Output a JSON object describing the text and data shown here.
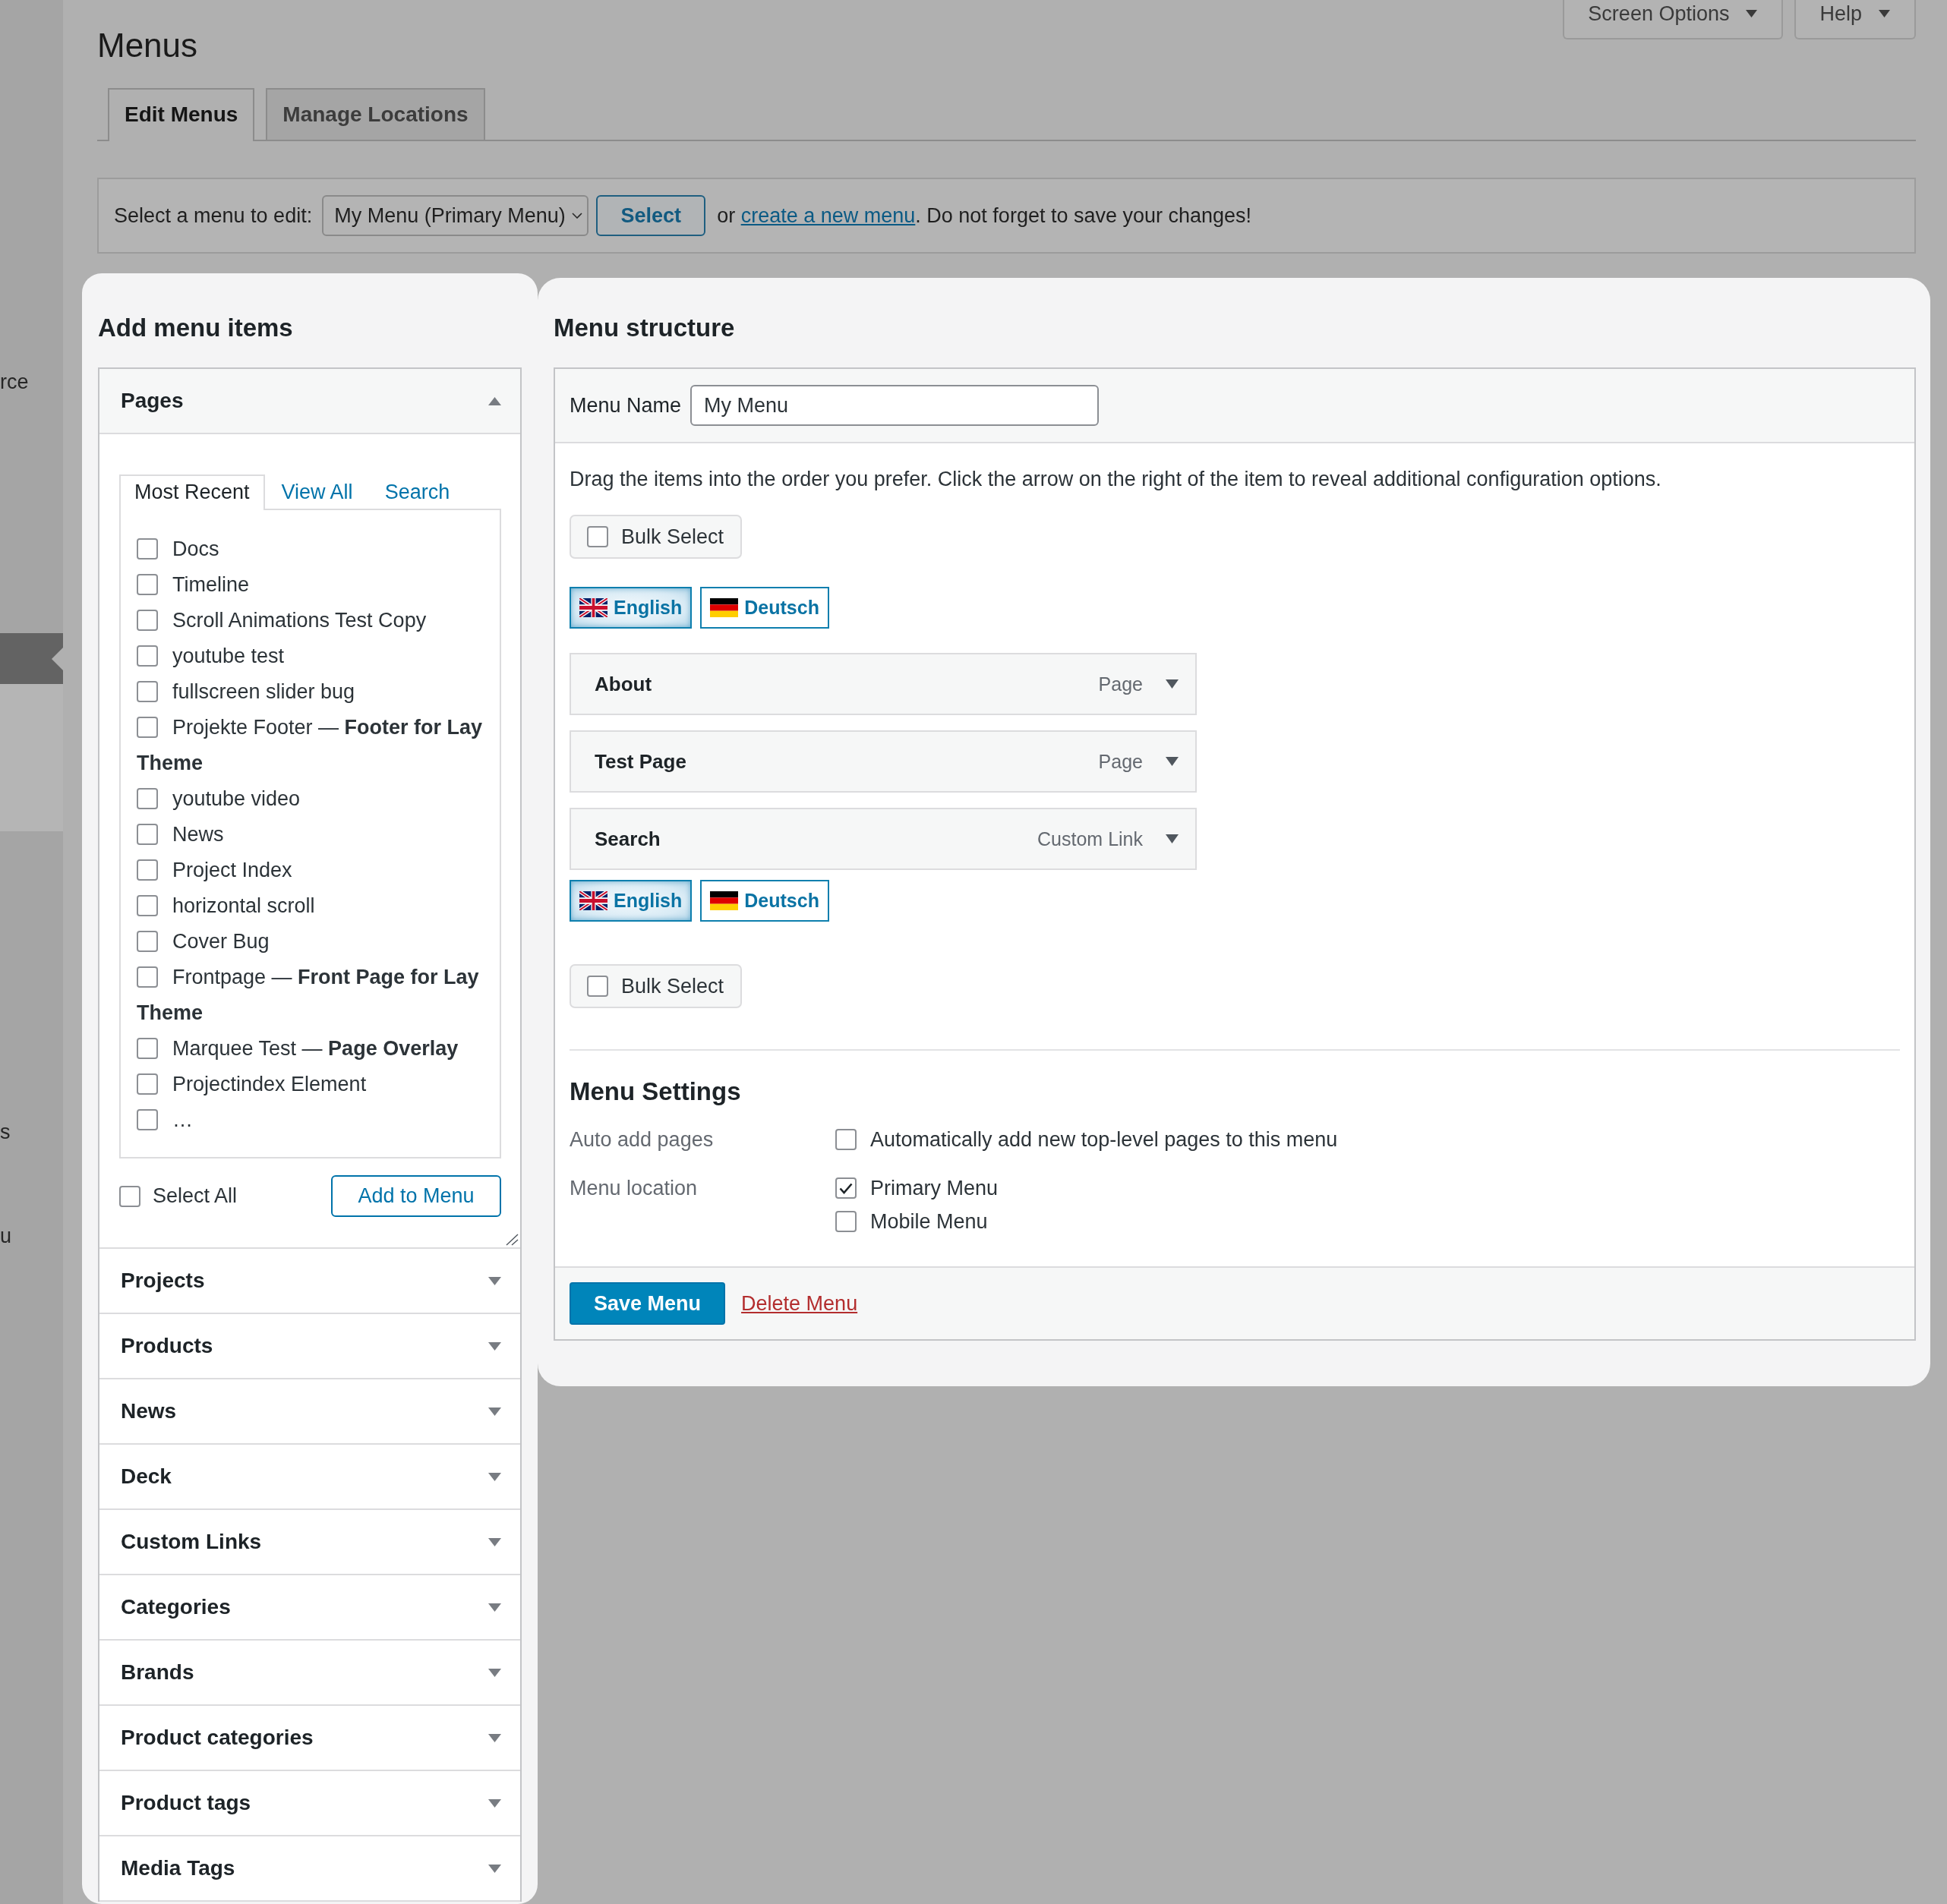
{
  "sidebar": {
    "items": [
      {
        "label": "rce",
        "selected": false
      },
      {
        "selected": true
      },
      {
        "label": "s",
        "selected": false
      },
      {
        "label": "u",
        "selected": false
      }
    ]
  },
  "header": {
    "title": "Menus",
    "screen_options": "Screen Options",
    "help": "Help"
  },
  "tabs": [
    {
      "label": "Edit Menus",
      "selected": true
    },
    {
      "label": "Manage Locations",
      "selected": false
    }
  ],
  "menu_select": {
    "label": "Select a menu to edit:",
    "dropdown": "My Menu (Primary Menu)",
    "button": "Select",
    "note": {
      "before": "or ",
      "link": "create a new menu",
      "after": ". Do not forget to save your changes!"
    }
  },
  "add_menu_items": {
    "title": "Add menu items",
    "sections": [
      {
        "title": "Pages",
        "expanded": true,
        "tabs": [
          {
            "label": "Most Recent",
            "selected": true
          },
          {
            "label": "View All",
            "selected": false
          },
          {
            "label": "Search",
            "selected": false
          }
        ],
        "items": [
          {
            "label": "Docs",
            "checked": false
          },
          {
            "label": "Timeline",
            "checked": false
          },
          {
            "label": "Scroll Animations Test Copy",
            "checked": false
          },
          {
            "label": "youtube test",
            "checked": false
          },
          {
            "label": "fullscreen slider bug",
            "checked": false
          },
          {
            "label": "Projekte Footer — **Footer for Lay Theme**",
            "checked": false
          },
          {
            "label": "youtube video",
            "checked": false
          },
          {
            "label": "News",
            "checked": false
          },
          {
            "label": "Project Index",
            "checked": false
          },
          {
            "label": "horizontal scroll",
            "checked": false
          },
          {
            "label": "Cover Bug",
            "checked": false
          },
          {
            "label": "Frontpage — **Front Page for Lay Theme**",
            "checked": false
          },
          {
            "label": "Marquee Test — **Page Overlay**",
            "checked": false
          },
          {
            "label": "Projectindex Element",
            "checked": false
          },
          {
            "label": "…",
            "checked": false
          }
        ],
        "select_all": {
          "label": "Select All",
          "checked": false
        },
        "add_button": "Add to Menu"
      },
      {
        "title": "Projects",
        "expanded": false
      },
      {
        "title": "Products",
        "expanded": false
      },
      {
        "title": "News",
        "expanded": false
      },
      {
        "title": "Deck",
        "expanded": false
      },
      {
        "title": "Custom Links",
        "expanded": false
      },
      {
        "title": "Categories",
        "expanded": false
      },
      {
        "title": "Brands",
        "expanded": false
      },
      {
        "title": "Product categories",
        "expanded": false
      },
      {
        "title": "Product tags",
        "expanded": false
      },
      {
        "title": "Media Tags",
        "expanded": false
      }
    ]
  },
  "menu_structure": {
    "title": "Menu structure",
    "menu_name": {
      "label": "Menu Name",
      "value": "My Menu"
    },
    "instructions": "Drag the items into the order you prefer. Click the arrow on the right of the item to reveal additional configuration options.",
    "bulk_select_top": {
      "label": "Bulk Select",
      "checked": false
    },
    "languages_top": [
      {
        "label": "English",
        "selected": true
      },
      {
        "label": "Deutsch",
        "selected": false
      }
    ],
    "items": [
      {
        "title": "About",
        "type": "Page"
      },
      {
        "title": "Test Page",
        "type": "Page"
      },
      {
        "title": "Search",
        "type": "Custom Link"
      }
    ],
    "languages_bottom": [
      {
        "label": "English",
        "selected": true
      },
      {
        "label": "Deutsch",
        "selected": false
      }
    ],
    "bulk_select_bottom": {
      "label": "Bulk Select",
      "checked": false
    },
    "settings": {
      "title": "Menu Settings",
      "rows": [
        {
          "label": "Auto add pages",
          "options": [
            {
              "label": "Automatically add new top-level pages to this menu",
              "checked": false
            }
          ]
        },
        {
          "label": "Menu location",
          "options": [
            {
              "label": "Primary Menu",
              "checked": true
            },
            {
              "label": "Mobile Menu",
              "checked": false
            }
          ]
        }
      ]
    },
    "save_button": "Save Menu",
    "delete_link": "Delete Menu"
  }
}
